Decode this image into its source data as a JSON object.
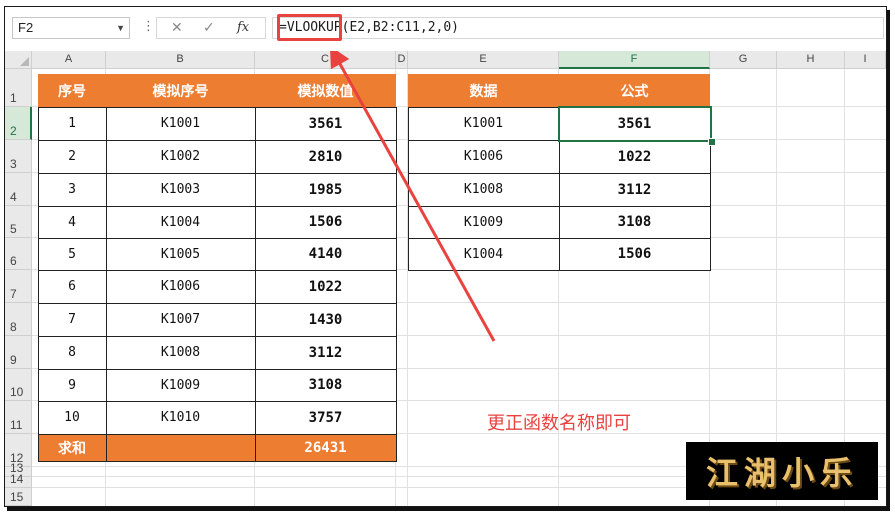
{
  "formula_bar": {
    "name_box": "F2",
    "cancel_icon": "✕",
    "enter_icon": "✓",
    "fx_label": "fx",
    "formula": "=VLOOKUP(E2,B2:C11,2,0)"
  },
  "columns": [
    "A",
    "B",
    "C",
    "D",
    "E",
    "F",
    "G",
    "H",
    "I"
  ],
  "rows": [
    "1",
    "2",
    "3",
    "4",
    "5",
    "6",
    "7",
    "8",
    "9",
    "10",
    "11",
    "12",
    "13",
    "14",
    "15"
  ],
  "table_left": {
    "headers": [
      "序号",
      "模拟序号",
      "模拟数值"
    ],
    "rows": [
      [
        "1",
        "K1001",
        "3561"
      ],
      [
        "2",
        "K1002",
        "2810"
      ],
      [
        "3",
        "K1003",
        "1985"
      ],
      [
        "4",
        "K1004",
        "1506"
      ],
      [
        "5",
        "K1005",
        "4140"
      ],
      [
        "6",
        "K1006",
        "1022"
      ],
      [
        "7",
        "K1007",
        "1430"
      ],
      [
        "8",
        "K1008",
        "3112"
      ],
      [
        "9",
        "K1009",
        "3108"
      ],
      [
        "10",
        "K1010",
        "3757"
      ]
    ],
    "sum_label": "求和",
    "sum_value": "26431"
  },
  "table_right": {
    "headers": [
      "数据",
      "公式"
    ],
    "rows": [
      [
        "K1001",
        "3561"
      ],
      [
        "K1006",
        "1022"
      ],
      [
        "K1008",
        "3112"
      ],
      [
        "K1009",
        "3108"
      ],
      [
        "K1004",
        "1506"
      ]
    ]
  },
  "annotation": "更正函数名称即可",
  "watermark": "江湖小乐",
  "colors": {
    "header_orange": "#ed7d31",
    "selection_green": "#217346",
    "annotation_red": "#e8433f"
  }
}
